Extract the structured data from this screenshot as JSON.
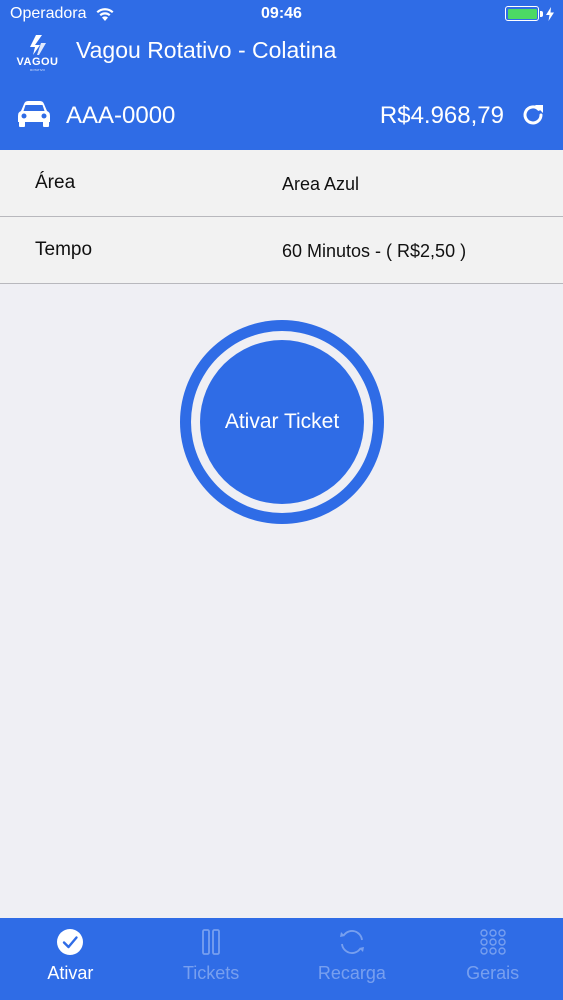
{
  "status_bar": {
    "carrier": "Operadora",
    "time": "09:46"
  },
  "header": {
    "logo_text": "VAGOU",
    "logo_sub": "ROTATIVO",
    "title": "Vagou Rotativo - Colatina",
    "plate": "AAA-0000",
    "balance": "R$4.968,79"
  },
  "form": {
    "rows": [
      {
        "label": "Área",
        "value": "Area Azul"
      },
      {
        "label": "Tempo",
        "value": "60 Minutos - ( R$2,50 )"
      }
    ]
  },
  "activate": {
    "label": "Ativar Ticket"
  },
  "tabs": [
    {
      "label": "Ativar",
      "icon": "check-circle-icon",
      "active": true
    },
    {
      "label": "Tickets",
      "icon": "tickets-icon",
      "active": false
    },
    {
      "label": "Recarga",
      "icon": "recharge-icon",
      "active": false
    },
    {
      "label": "Gerais",
      "icon": "grid-icon",
      "active": false
    }
  ],
  "colors": {
    "primary": "#2f6ce6",
    "background": "#efeff4",
    "battery": "#4cd964"
  }
}
